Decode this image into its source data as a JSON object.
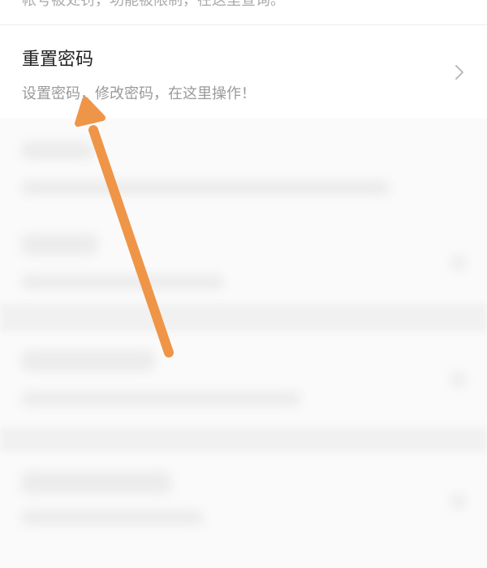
{
  "top_row": {
    "text": "帐号被处罚，功能被限制，在这里查询。"
  },
  "reset_password": {
    "title": "重置密码",
    "subtitle": "设置密码，修改密码，在这里操作！"
  },
  "icons": {
    "chevron": "chevron-right-icon",
    "annotation": "arrow-annotation"
  },
  "colors": {
    "arrow": "#ef9548",
    "title_text": "#222222",
    "subtitle_text": "#9a9a9a",
    "background": "#ffffff"
  }
}
